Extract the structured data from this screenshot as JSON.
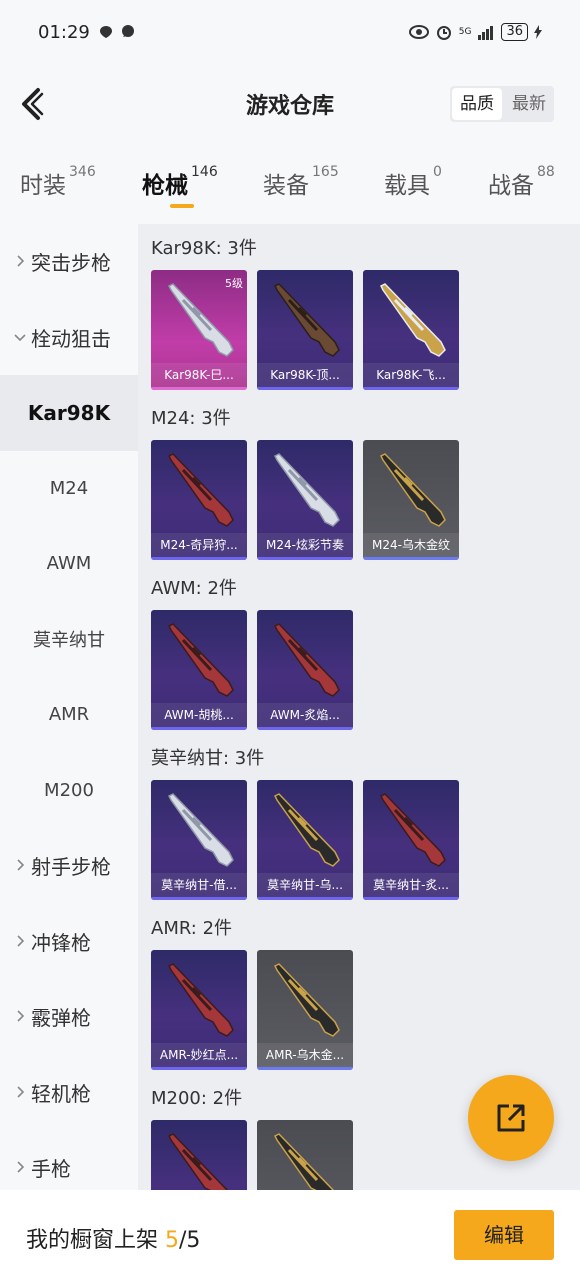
{
  "status": {
    "time": "01:29",
    "network": "5G",
    "battery": "36"
  },
  "header": {
    "title": "游戏仓库",
    "sort_options": [
      "品质",
      "最新"
    ]
  },
  "tabs": [
    {
      "label": "时装",
      "count": "346"
    },
    {
      "label": "枪械",
      "count": "146"
    },
    {
      "label": "装备",
      "count": "165"
    },
    {
      "label": "载具",
      "count": "0"
    },
    {
      "label": "战备",
      "count": "88"
    }
  ],
  "sidebar": [
    {
      "label": "突击步枪",
      "type": "category"
    },
    {
      "label": "栓动狙击",
      "type": "category-open"
    },
    {
      "label": "Kar98K",
      "type": "sub-active"
    },
    {
      "label": "M24",
      "type": "sub"
    },
    {
      "label": "AWM",
      "type": "sub"
    },
    {
      "label": "莫辛纳甘",
      "type": "sub"
    },
    {
      "label": "AMR",
      "type": "sub"
    },
    {
      "label": "M200",
      "type": "sub"
    },
    {
      "label": "射手步枪",
      "type": "category"
    },
    {
      "label": "冲锋枪",
      "type": "category"
    },
    {
      "label": "霰弹枪",
      "type": "category"
    },
    {
      "label": "轻机枪",
      "type": "category"
    },
    {
      "label": "手枪",
      "type": "category"
    }
  ],
  "groups": [
    {
      "title": "Kar98K: 3件",
      "items": [
        {
          "name": "Kar98K-巳...",
          "style": "pink",
          "badge": "5级",
          "gun": "silver"
        },
        {
          "name": "Kar98K-顶...",
          "style": "purple",
          "gun": "brown"
        },
        {
          "name": "Kar98K-飞...",
          "style": "purple",
          "gun": "gold"
        }
      ]
    },
    {
      "title": "M24: 3件",
      "items": [
        {
          "name": "M24-奇异狩...",
          "style": "purple",
          "gun": "red"
        },
        {
          "name": "M24-炫彩节奏",
          "style": "purple",
          "gun": "silver"
        },
        {
          "name": "M24-乌木金纹",
          "style": "gray",
          "gun": "black"
        }
      ]
    },
    {
      "title": "AWM: 2件",
      "items": [
        {
          "name": "AWM-胡桃...",
          "style": "purple",
          "gun": "red"
        },
        {
          "name": "AWM-炙焰...",
          "style": "purple",
          "gun": "red"
        }
      ]
    },
    {
      "title": "莫辛纳甘: 3件",
      "items": [
        {
          "name": "莫辛纳甘-借...",
          "style": "purple",
          "gun": "silver"
        },
        {
          "name": "莫辛纳甘-乌...",
          "style": "purple",
          "gun": "black"
        },
        {
          "name": "莫辛纳甘-炙...",
          "style": "purple",
          "gun": "red"
        }
      ]
    },
    {
      "title": "AMR: 2件",
      "items": [
        {
          "name": "AMR-妙红点...",
          "style": "purple",
          "gun": "red"
        },
        {
          "name": "AMR-乌木金...",
          "style": "gray",
          "gun": "black"
        }
      ]
    },
    {
      "title": "M200: 2件",
      "items": [
        {
          "name": "",
          "style": "purple",
          "gun": "red"
        },
        {
          "name": "",
          "style": "gray",
          "gun": "black"
        }
      ]
    }
  ],
  "bottom": {
    "text": "我的橱窗上架",
    "count": "5",
    "total": "/5",
    "edit_label": "编辑"
  },
  "colors": {
    "accent": "#f5a81c"
  }
}
